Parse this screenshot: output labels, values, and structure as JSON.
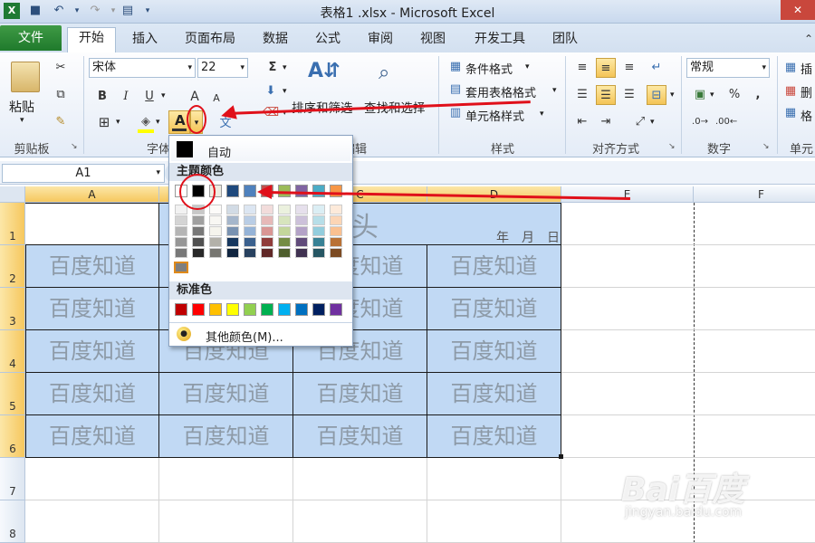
{
  "window": {
    "title": "表格1 .xlsx - Microsoft Excel"
  },
  "tabs": [
    "文件",
    "开始",
    "插入",
    "页面布局",
    "数据",
    "公式",
    "审阅",
    "视图",
    "开发工具",
    "团队"
  ],
  "clipboard": {
    "paste_label": "粘贴",
    "group_label": "剪贴板"
  },
  "font": {
    "name": "宋体",
    "size": "22",
    "bold": "B",
    "italic": "I",
    "underline": "U",
    "grow": "A",
    "shrink": "A",
    "font_color": "A",
    "phonetic": "文",
    "group_label": "字体"
  },
  "editing": {
    "sort_label": "排序和筛选",
    "find_label": "查找和选择",
    "group_label": "编辑"
  },
  "styles": {
    "conditional": "条件格式",
    "table": "套用表格格式",
    "cell": "单元格样式",
    "group_label": "样式"
  },
  "alignment": {
    "group_label": "对齐方式"
  },
  "number": {
    "format": "常规",
    "percent": "%",
    "comma": ",",
    "group_label": "数字"
  },
  "cells": {
    "insert": "插",
    "delete": "删",
    "format": "格",
    "group_label": "单元"
  },
  "formula_bar": {
    "name_box": "A1"
  },
  "columns": [
    "A",
    "B",
    "C",
    "D",
    "E",
    "F"
  ],
  "rows": [
    "1",
    "2",
    "3",
    "4",
    "5",
    "6",
    "7",
    "8"
  ],
  "sheet": {
    "header_cell_text": "头",
    "date_text": "年　月　日",
    "cell_text": "百度知道"
  },
  "color_menu": {
    "auto_label": "自动",
    "theme_label": "主题颜色",
    "standard_label": "标准色",
    "more_label": "其他颜色(M)...",
    "theme_colors": [
      "#ffffff",
      "#000000",
      "#eeece1",
      "#1f497d",
      "#4f81bd",
      "#c0504d",
      "#9bbb59",
      "#8064a2",
      "#4bacc6",
      "#f79646"
    ],
    "standard_colors": [
      "#c00000",
      "#ff0000",
      "#ffc000",
      "#ffff00",
      "#92d050",
      "#00b050",
      "#00b0f0",
      "#0070c0",
      "#002060",
      "#7030a0"
    ]
  },
  "watermark": {
    "logo": "Bai百度",
    "site": "jingyan.baidu.com"
  }
}
